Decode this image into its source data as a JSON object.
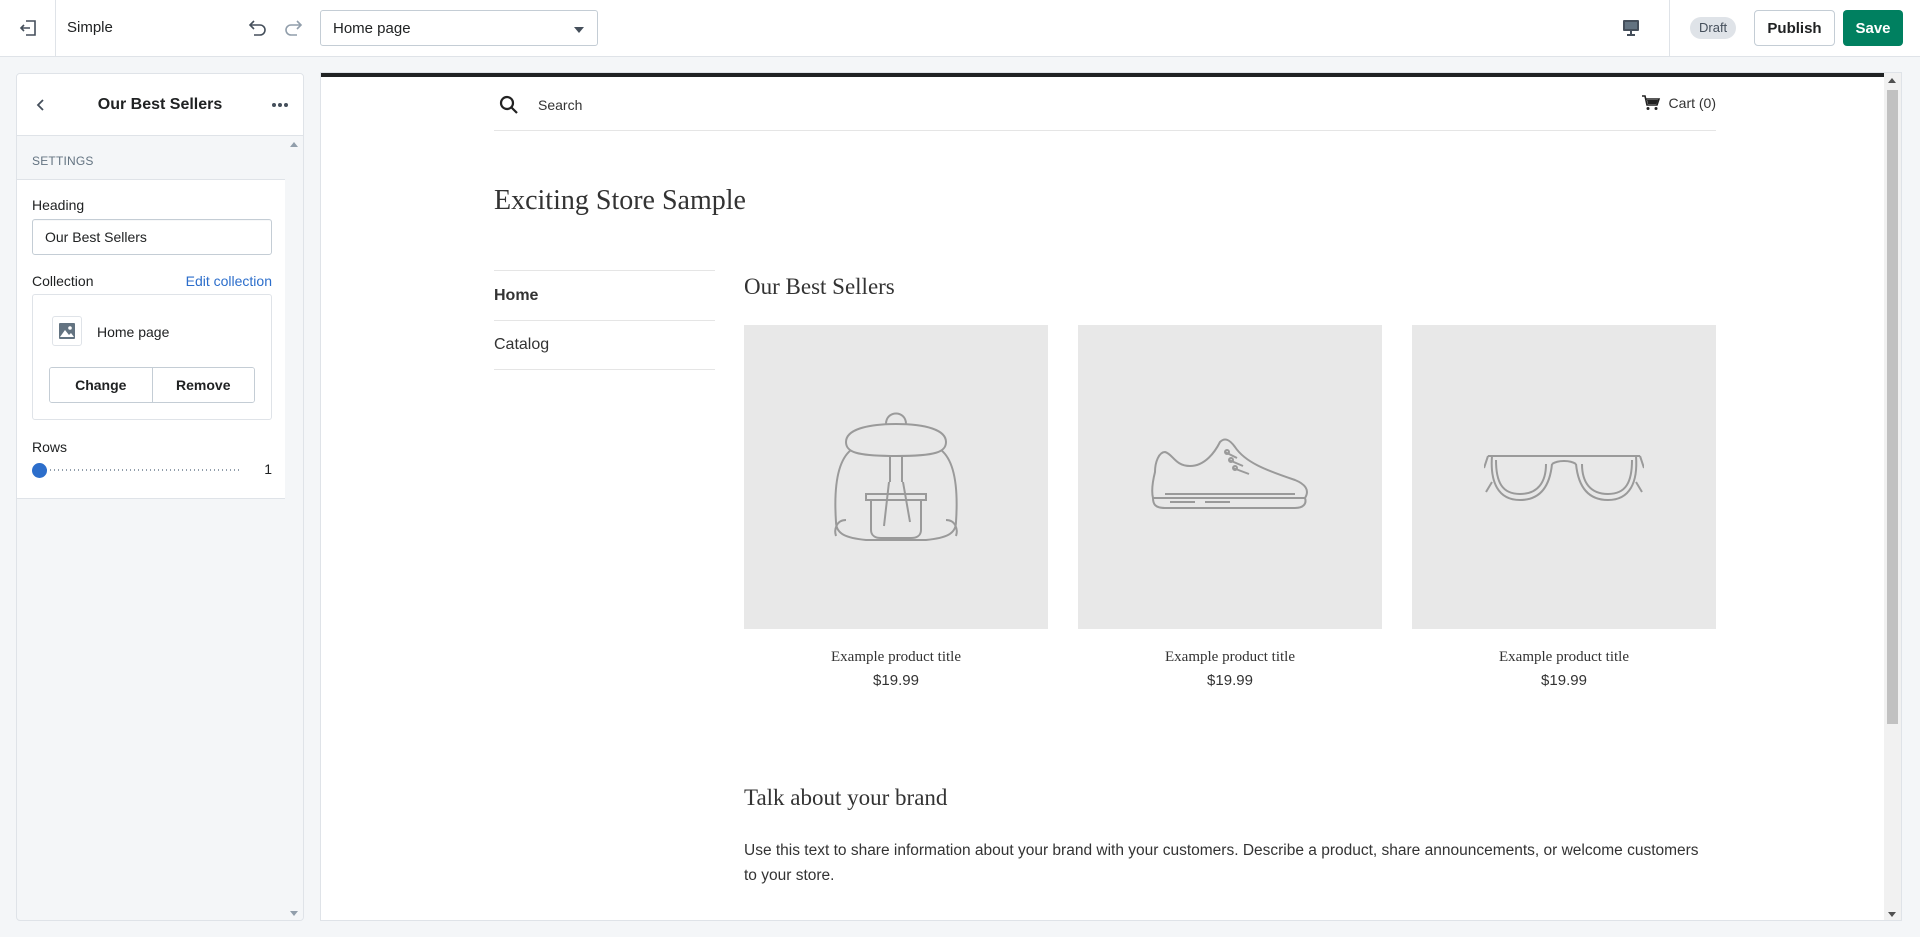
{
  "topbar": {
    "theme_name": "Simple",
    "page_select_value": "Home page",
    "status_badge": "Draft",
    "publish_label": "Publish",
    "save_label": "Save",
    "icons": {
      "exit": "exit-icon",
      "undo": "undo-icon",
      "redo": "redo-icon",
      "device": "desktop-icon",
      "caret": "caret-down-icon"
    }
  },
  "sidebar": {
    "title": "Our Best Sellers",
    "section_label": "SETTINGS",
    "heading_label": "Heading",
    "heading_value": "Our Best Sellers",
    "collection_label": "Collection",
    "edit_collection_label": "Edit collection",
    "collection_name": "Home page",
    "change_label": "Change",
    "remove_label": "Remove",
    "rows_label": "Rows",
    "rows_value": "1",
    "rows_fraction": 0
  },
  "preview": {
    "search_placeholder": "Search",
    "cart_label": "Cart (0)",
    "store_name": "Exciting Store Sample",
    "nav": [
      {
        "label": "Home"
      },
      {
        "label": "Catalog"
      }
    ],
    "section_heading": "Our Best Sellers",
    "products": [
      {
        "title": "Example product title",
        "price": "$19.99",
        "icon": "backpack-icon"
      },
      {
        "title": "Example product title",
        "price": "$19.99",
        "icon": "sneaker-icon"
      },
      {
        "title": "Example product title",
        "price": "$19.99",
        "icon": "glasses-icon"
      }
    ],
    "brand_heading": "Talk about your brand",
    "brand_text": "Use this text to share information about your brand with your customers. Describe a product, share announcements, or welcome customers to your store."
  },
  "colors": {
    "accent_green": "#008060",
    "link_blue": "#2c6ecb",
    "placeholder_gray": "#e8e8e8"
  }
}
